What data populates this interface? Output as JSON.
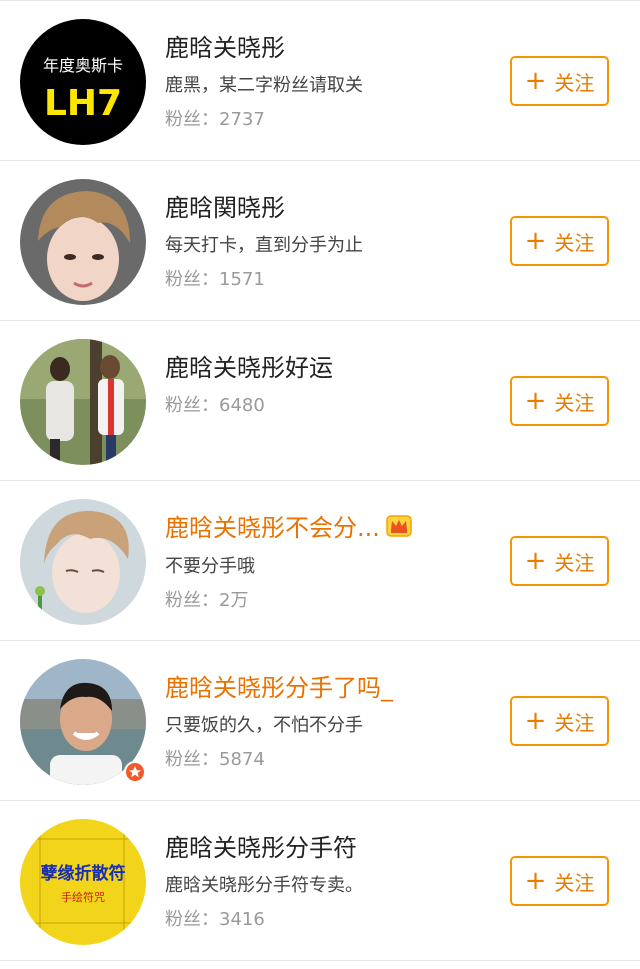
{
  "follow_label": "关注",
  "fans_label": "粉丝：",
  "users": [
    {
      "name": "鹿晗关晓彤",
      "name_color": "default",
      "bio": "鹿黑，某二字粉丝请取关",
      "fans": "2737",
      "avatar_text_top": "年度奥斯卡",
      "avatar_text_main": "LH7"
    },
    {
      "name": "鹿晗関晓彤",
      "name_color": "default",
      "bio": "每天打卡，直到分手为止",
      "fans": "1571"
    },
    {
      "name": "鹿晗关晓彤好运",
      "name_color": "default",
      "bio": "",
      "fans": "6480"
    },
    {
      "name": "鹿晗关晓彤不会分...",
      "name_color": "orange",
      "bio": "不要分手哦",
      "fans": "2万"
    },
    {
      "name": "鹿晗关晓彤分手了吗_",
      "name_color": "orange",
      "bio": "只要饭的久，不怕不分手",
      "fans": "5874"
    },
    {
      "name": "鹿晗关晓彤分手符",
      "name_color": "default",
      "bio": "鹿晗关晓彤分手符专卖。",
      "fans": "3416",
      "avatar_text_main": "孽缘折散符",
      "avatar_text_sub": "手绘符咒"
    }
  ]
}
